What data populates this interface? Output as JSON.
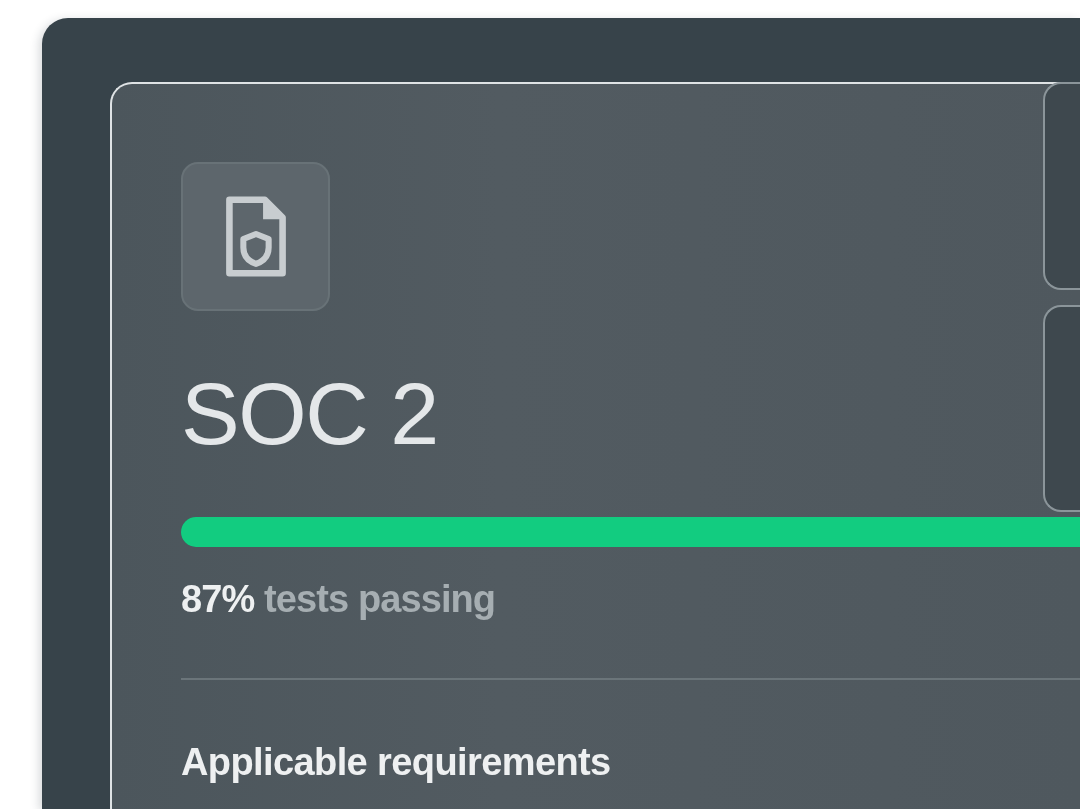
{
  "framework": {
    "title": "SOC 2",
    "progress": {
      "level": 0.87
    },
    "summary": "**87%** tests passing",
    "section_heading": "Applicable requirements"
  }
}
